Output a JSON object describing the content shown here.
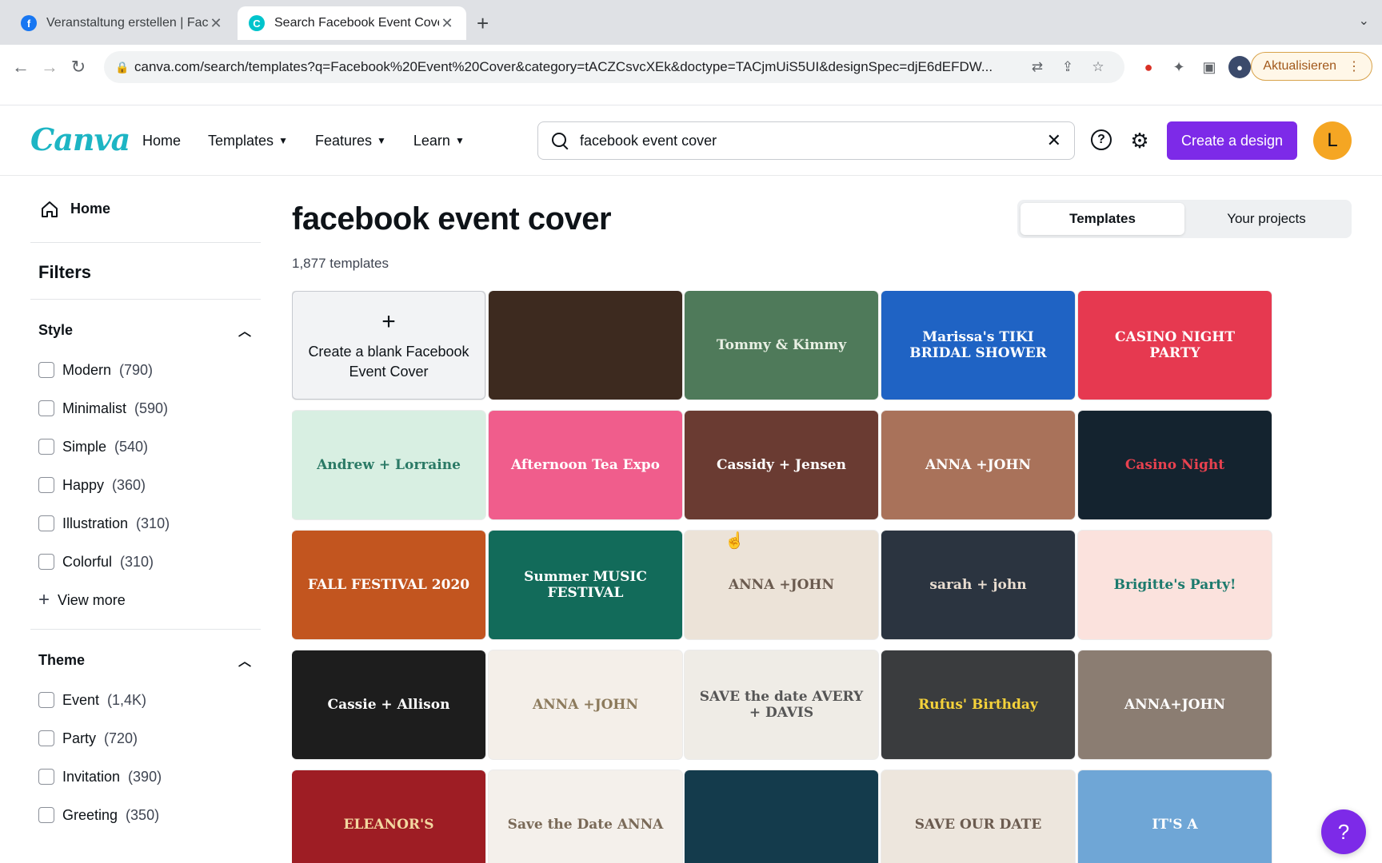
{
  "browser": {
    "tabs": [
      {
        "title": "Veranstaltung erstellen | Faceb",
        "favicon": "facebook-icon",
        "color": "#1877f2"
      },
      {
        "title": "Search Facebook Event Cover",
        "favicon": "canva-icon",
        "color": "#00c4cc"
      }
    ],
    "url": "canva.com/search/templates?q=Facebook%20Event%20Cover&category=tACZCsvcXEk&doctype=TACjmUiS5UI&designSpec=djE6dEFDW...",
    "update_label": "Aktualisieren"
  },
  "header": {
    "logo": "Canva",
    "nav": [
      "Home",
      "Templates",
      "Features",
      "Learn"
    ],
    "search_value": "facebook event cover",
    "create_label": "Create a design",
    "avatar_initial": "L",
    "accent": "#7d2ae8"
  },
  "sidebar": {
    "home": "Home",
    "filters": "Filters",
    "style_title": "Style",
    "style_options": [
      {
        "name": "Modern",
        "count": "(790)"
      },
      {
        "name": "Minimalist",
        "count": "(590)"
      },
      {
        "name": "Simple",
        "count": "(540)"
      },
      {
        "name": "Happy",
        "count": "(360)"
      },
      {
        "name": "Illustration",
        "count": "(310)"
      },
      {
        "name": "Colorful",
        "count": "(310)"
      }
    ],
    "view_more": "View more",
    "theme_title": "Theme",
    "theme_options": [
      {
        "name": "Event",
        "count": "(1,4K)"
      },
      {
        "name": "Party",
        "count": "(720)"
      },
      {
        "name": "Invitation",
        "count": "(390)"
      },
      {
        "name": "Greeting",
        "count": "(350)"
      }
    ]
  },
  "main": {
    "title": "facebook event cover",
    "count": "1,877 templates",
    "tabs": [
      "Templates",
      "Your projects"
    ],
    "blank_label": "Create a blank Facebook Event Cover",
    "templates": [
      {
        "text": "",
        "bg": "#3d2a1f",
        "fg": "#fff"
      },
      {
        "text": "Tommy & Kimmy",
        "bg": "#4f7a5a",
        "fg": "#e9f0e4"
      },
      {
        "text": "Marissa's TIKI BRIDAL SHOWER",
        "bg": "#1f63c4",
        "fg": "#fff"
      },
      {
        "text": "CASINO NIGHT PARTY",
        "bg": "#e63950",
        "fg": "#fff"
      },
      {
        "text": "Andrew + Lorraine",
        "bg": "#d8efe2",
        "fg": "#2b7a66"
      },
      {
        "text": "Afternoon Tea Expo",
        "bg": "#f05d8c",
        "fg": "#fff"
      },
      {
        "text": "Cassidy + Jensen",
        "bg": "#6a3b32",
        "fg": "#fff"
      },
      {
        "text": "ANNA +JOHN",
        "bg": "#a9725a",
        "fg": "#fff"
      },
      {
        "text": "Casino Night",
        "bg": "#14232f",
        "fg": "#e8414f"
      },
      {
        "text": "FALL FESTIVAL 2020",
        "bg": "#c2551f",
        "fg": "#fff"
      },
      {
        "text": "Summer MUSIC FESTIVAL",
        "bg": "#126b5a",
        "fg": "#fff"
      },
      {
        "text": "ANNA +JOHN",
        "bg": "#ece3d8",
        "fg": "#6b5b4f"
      },
      {
        "text": "sarah + john",
        "bg": "#2b3440",
        "fg": "#e9ddd0"
      },
      {
        "text": "Brigitte's Party!",
        "bg": "#fbe2dd",
        "fg": "#1c7a6d"
      },
      {
        "text": "Cassie + Allison",
        "bg": "#1d1d1d",
        "fg": "#fff"
      },
      {
        "text": "ANNA +JOHN",
        "bg": "#f4efe9",
        "fg": "#8c7a5c"
      },
      {
        "text": "SAVE the date AVERY + DAVIS",
        "bg": "#efece6",
        "fg": "#555"
      },
      {
        "text": "Rufus' Birthday",
        "bg": "#3a3c3e",
        "fg": "#f5d23a"
      },
      {
        "text": "ANNA+JOHN",
        "bg": "#8b7d72",
        "fg": "#fff"
      },
      {
        "text": "ELEANOR'S",
        "bg": "#9e1d24",
        "fg": "#f3d7a0"
      },
      {
        "text": "Save the Date ANNA",
        "bg": "#f4f0eb",
        "fg": "#7a6a58"
      },
      {
        "text": "",
        "bg": "#143b4c",
        "fg": "#fff"
      },
      {
        "text": "SAVE OUR DATE",
        "bg": "#ede6dd",
        "fg": "#6b5b4f"
      },
      {
        "text": "IT'S A",
        "bg": "#6fa6d6",
        "fg": "#fff"
      }
    ]
  }
}
